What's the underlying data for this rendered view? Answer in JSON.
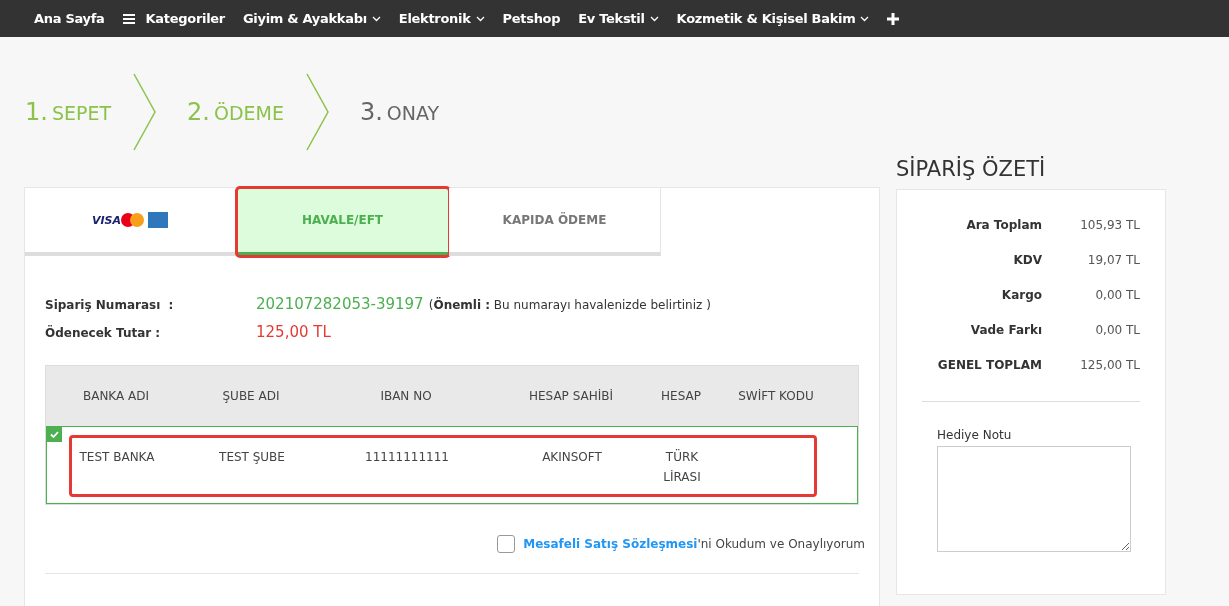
{
  "nav": [
    {
      "label": "Ana Sayfa",
      "kind": "link",
      "has_dropdown": false
    },
    {
      "label": "Kategoriler",
      "kind": "menu",
      "has_dropdown": false
    },
    {
      "label": "Giyim & Ayakkabı",
      "kind": "link",
      "has_dropdown": true
    },
    {
      "label": "Elektronik",
      "kind": "link",
      "has_dropdown": true
    },
    {
      "label": "Petshop",
      "kind": "link",
      "has_dropdown": false
    },
    {
      "label": "Ev Tekstil",
      "kind": "link",
      "has_dropdown": true
    },
    {
      "label": "Kozmetik & Kişisel Bakim",
      "kind": "link",
      "has_dropdown": true
    },
    {
      "kind": "plus"
    }
  ],
  "steps": [
    {
      "number": "1.",
      "label": "SEPET",
      "active": true
    },
    {
      "number": "2.",
      "label": "ÖDEME",
      "active": true
    },
    {
      "number": "3.",
      "label": "ONAY",
      "active": false
    }
  ],
  "payment_tabs": [
    {
      "kind": "cards",
      "logo_text": "VISA",
      "selected": false,
      "highlighted": false
    },
    {
      "kind": "text",
      "label": "HAVALE/EFT",
      "selected": true,
      "highlighted": true
    },
    {
      "kind": "text",
      "label": "KAPIDA ÖDEME",
      "selected": false,
      "highlighted": false
    }
  ],
  "order": {
    "number_label": "Sipariş Numarası  :",
    "number": "202107282053-39197",
    "note": "(**Önemli :** Bu numarayı havalenizde belirtiniz )",
    "amount_label": "Ödenecek Tutar :",
    "amount": "125,00 TL"
  },
  "bank_table": {
    "columns": [
      "BANKA ADI",
      "ŞUBE ADI",
      "IBAN NO",
      "HESAP SAHİBİ",
      "HESAP",
      "SWİFT KODU"
    ],
    "rows": [
      {
        "cells": [
          "TEST BANKA",
          "TEST ŞUBE",
          "11111111111",
          "AKINSOFT",
          "TÜRK LİRASI",
          ""
        ],
        "selected": true,
        "highlighted": true
      }
    ]
  },
  "agreement": {
    "checked": false,
    "link": "Mesafeli Satış Sözleşmesi",
    "text": "'ni Okudum ve Onaylıyorum"
  },
  "summary": {
    "title": "SİPARİŞ ÖZETİ",
    "rows": [
      {
        "label": "Ara Toplam",
        "value": "105,93 TL"
      },
      {
        "label": "KDV",
        "value": "19,07 TL"
      },
      {
        "label": "Kargo",
        "value": "0,00 TL"
      },
      {
        "label": "Vade Farkı",
        "value": "0,00 TL"
      },
      {
        "label": "GENEL TOPLAM",
        "value": "125,00 TL"
      }
    ],
    "gift_label": "Hediye Notu"
  }
}
